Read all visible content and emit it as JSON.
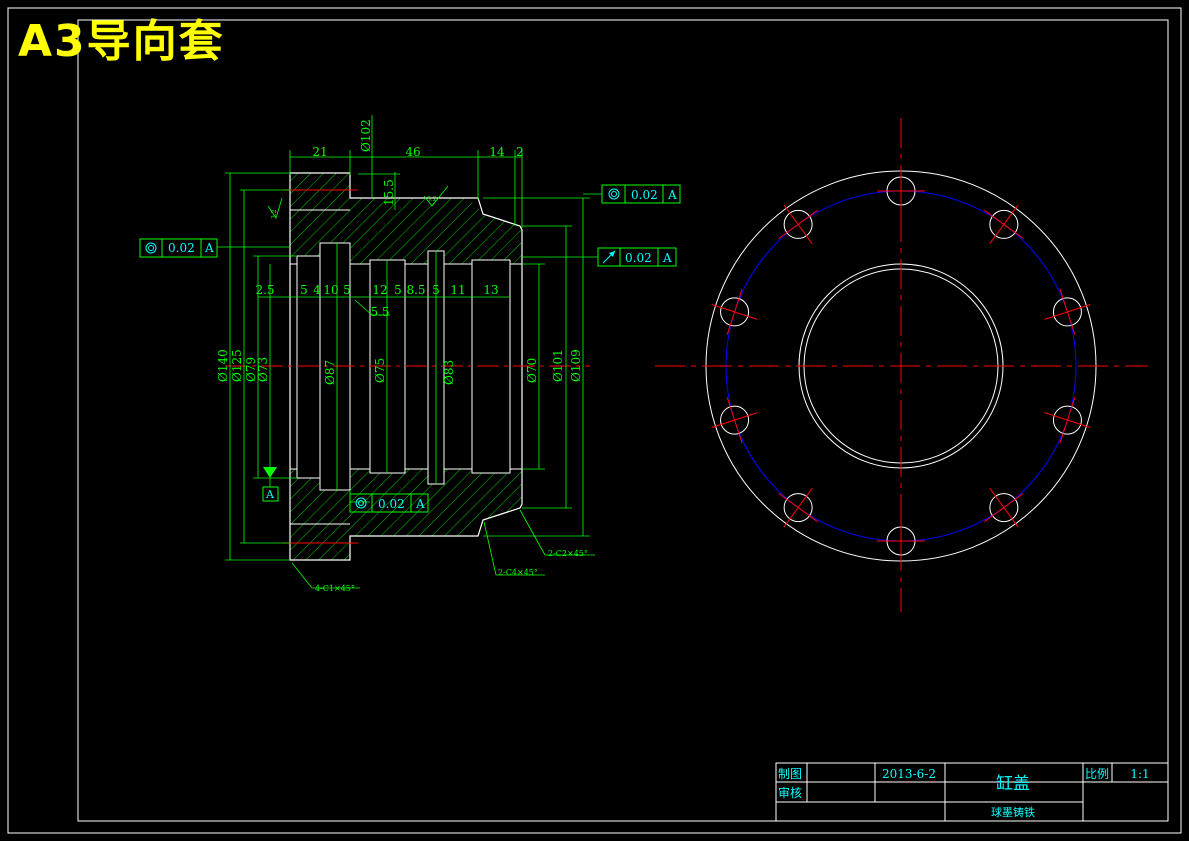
{
  "title": "A3导向套",
  "colors": {
    "background": "#000000",
    "title": "#ffff00",
    "outline": "#ffffff",
    "dimension": "#00ff00",
    "text": "#00ffff",
    "centerline": "#ff0000",
    "hidden_circle": "#0000ff"
  },
  "dimensions": {
    "top": [
      "21",
      "46",
      "14",
      "2",
      "Ø102",
      "15.5"
    ],
    "grooves": [
      "2.5",
      "5",
      "4",
      "10",
      "5",
      "12",
      "5",
      "8.5",
      "5",
      "11",
      "13"
    ],
    "groove_extra": "5.5",
    "left_diameters": [
      "Ø140",
      "Ø125",
      "Ø79",
      "Ø73"
    ],
    "inner_diameters": [
      "Ø87",
      "Ø75",
      "Ø83",
      "Ø70"
    ],
    "right_diameters": [
      "Ø101",
      "Ø109"
    ],
    "chamfers": [
      "4-C1×45°",
      "2-C4×45°",
      "2-C2×45°"
    ],
    "roughness": [
      "3.2",
      "3.2"
    ]
  },
  "tolerances": {
    "left": {
      "value": "0.02",
      "datum": "A"
    },
    "top_right": {
      "value": "0.02",
      "datum": "A"
    },
    "runout": {
      "value": "0.02",
      "datum": "A"
    },
    "bottom": {
      "value": "0.02",
      "datum": "A"
    }
  },
  "datum_label": "A",
  "title_block": {
    "drawn_label": "制图",
    "checked_label": "审核",
    "date": "2013-6-2",
    "part_name": "缸盖",
    "scale_label": "比例",
    "scale_value": "1:1",
    "material": "球墨铸铁"
  }
}
